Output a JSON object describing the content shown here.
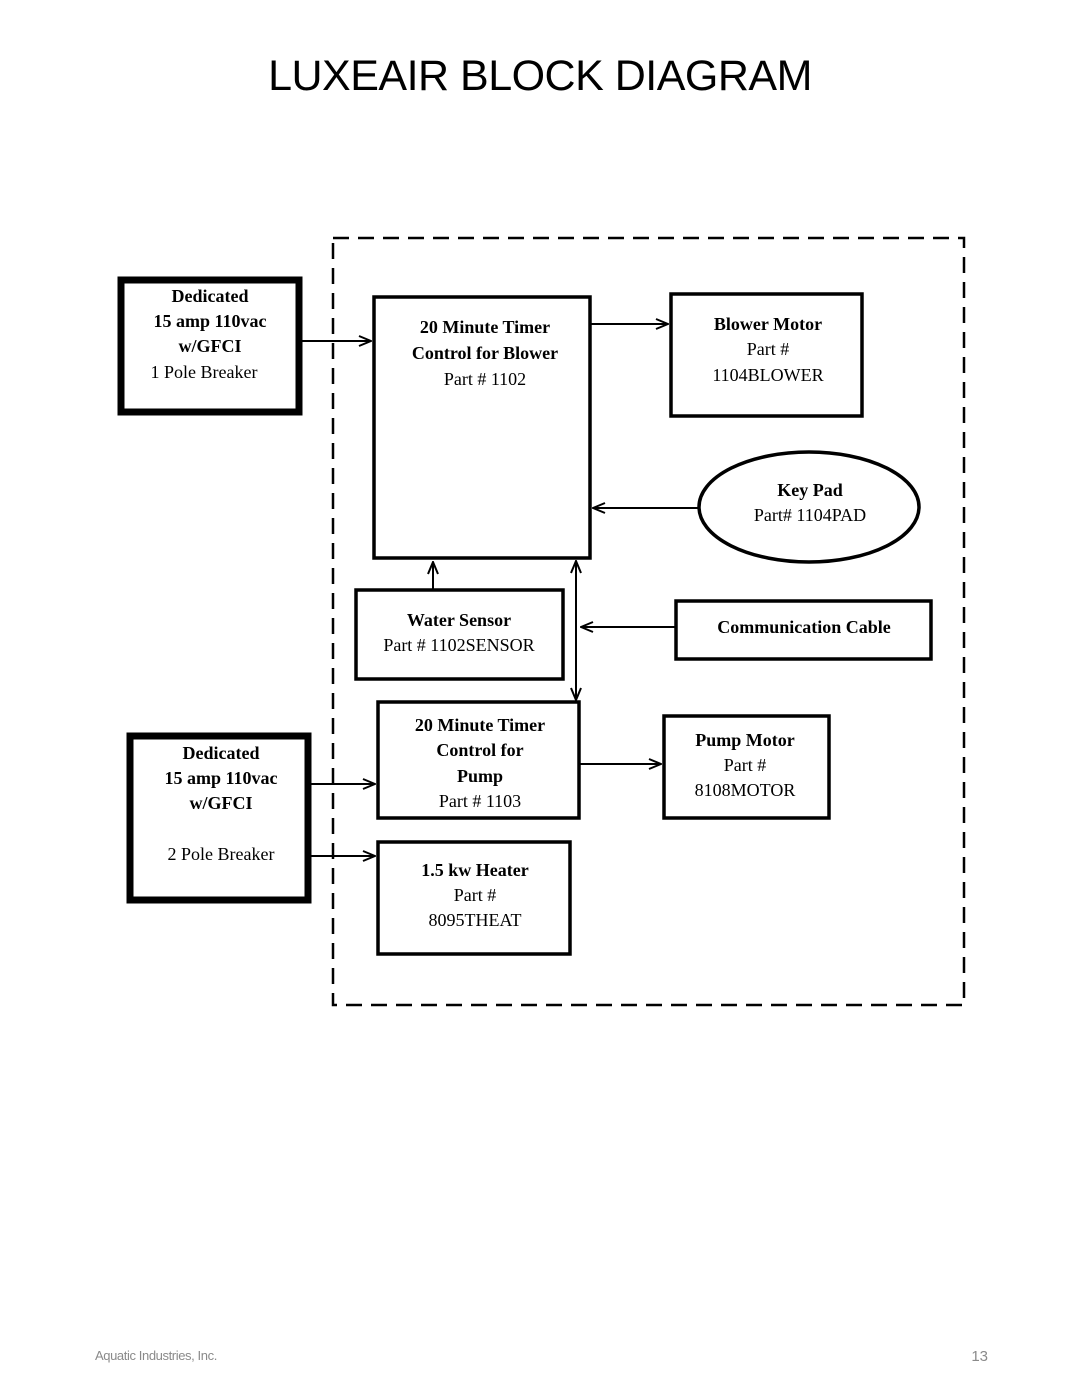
{
  "page": {
    "title": "LUXEAIR BLOCK DIAGRAM",
    "footer_company": "Aquatic Industries, Inc.",
    "page_number": "13"
  },
  "diagram": {
    "boundary": {
      "style": "dashed",
      "label": ""
    },
    "nodes": {
      "power1": {
        "lines_bold": [
          "Dedicated",
          "15 amp 110vac",
          "w/GFCI"
        ],
        "lines": [
          "1 Pole Breaker"
        ]
      },
      "power2": {
        "lines_bold": [
          "Dedicated",
          "15 amp 110vac",
          "w/GFCI"
        ],
        "lines": [
          "2 Pole Breaker"
        ]
      },
      "blower_timer": {
        "lines_bold": [
          "20 Minute Timer",
          "Control for Blower"
        ],
        "lines": [
          "Part # 1102"
        ]
      },
      "blower_motor": {
        "lines_bold": [
          "Blower Motor"
        ],
        "lines": [
          "Part #",
          "1104BLOWER"
        ]
      },
      "key_pad": {
        "lines_bold": [
          "Key Pad"
        ],
        "lines": [
          "Part# 1104PAD"
        ]
      },
      "water_sensor": {
        "lines_bold": [
          "Water Sensor"
        ],
        "lines": [
          "Part # 1102SENSOR"
        ]
      },
      "comm_cable": {
        "lines_bold": [
          "Communication Cable"
        ],
        "lines": []
      },
      "pump_timer": {
        "lines_bold": [
          "20 Minute Timer",
          "Control for",
          "Pump"
        ],
        "lines": [
          "Part # 1103"
        ]
      },
      "pump_motor": {
        "lines_bold": [
          "Pump Motor"
        ],
        "lines": [
          "Part #",
          "8108MOTOR"
        ]
      },
      "heater": {
        "lines_bold": [
          "1.5 kw Heater"
        ],
        "lines": [
          "Part #",
          "8095THEAT"
        ]
      }
    },
    "edges": [
      {
        "from": "power1",
        "to": "blower_timer"
      },
      {
        "from": "blower_timer",
        "to": "blower_motor"
      },
      {
        "from": "key_pad",
        "to": "blower_timer"
      },
      {
        "from": "water_sensor",
        "to": "blower_timer"
      },
      {
        "from": "blower_timer",
        "to": "pump_timer",
        "bidirectional": true
      },
      {
        "from": "comm_cable",
        "to": "blower_timer/pump_timer link"
      },
      {
        "from": "power2",
        "to": "pump_timer"
      },
      {
        "from": "pump_timer",
        "to": "pump_motor"
      },
      {
        "from": "power2",
        "to": "heater"
      }
    ]
  }
}
